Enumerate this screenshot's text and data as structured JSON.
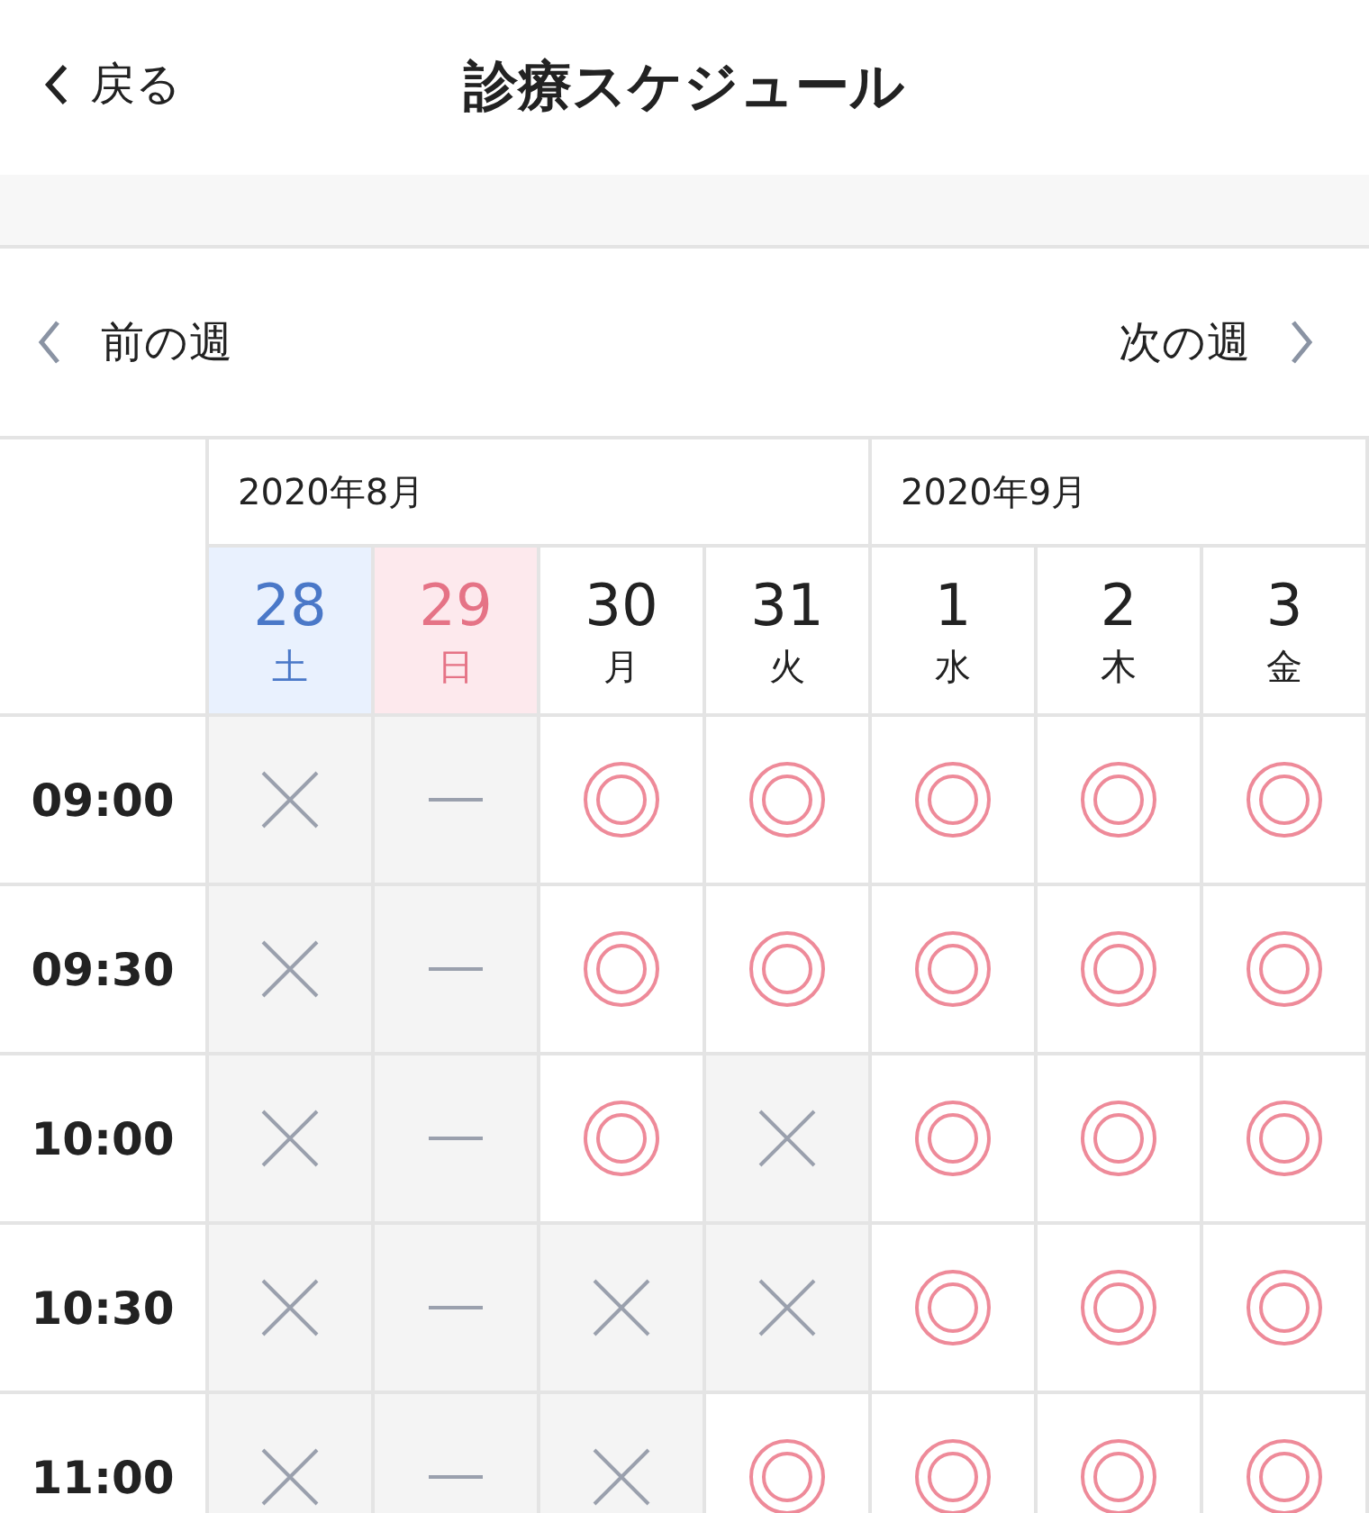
{
  "header": {
    "back": "戻る",
    "title": "診療スケジュール"
  },
  "week_nav": {
    "prev": "前の週",
    "next": "次の週"
  },
  "months": [
    {
      "label": "2020年8月",
      "days": [
        {
          "date": "28",
          "weekday": "土",
          "kind": "sat"
        },
        {
          "date": "29",
          "weekday": "日",
          "kind": "sun"
        },
        {
          "date": "30",
          "weekday": "月",
          "kind": "weekday"
        },
        {
          "date": "31",
          "weekday": "火",
          "kind": "weekday"
        }
      ]
    },
    {
      "label": "2020年9月",
      "days": [
        {
          "date": "1",
          "weekday": "水",
          "kind": "weekday"
        },
        {
          "date": "2",
          "weekday": "木",
          "kind": "weekday"
        },
        {
          "date": "3",
          "weekday": "金",
          "kind": "weekday"
        }
      ]
    }
  ],
  "slots": [
    {
      "time": "09:00",
      "cells": [
        {
          "kind": "full"
        },
        {
          "kind": "closed"
        },
        {
          "kind": "available"
        },
        {
          "kind": "available"
        },
        {
          "kind": "available"
        },
        {
          "kind": "available"
        },
        {
          "kind": "available"
        }
      ]
    },
    {
      "time": "09:30",
      "cells": [
        {
          "kind": "full"
        },
        {
          "kind": "closed"
        },
        {
          "kind": "available"
        },
        {
          "kind": "available"
        },
        {
          "kind": "available"
        },
        {
          "kind": "available"
        },
        {
          "kind": "available"
        }
      ]
    },
    {
      "time": "10:00",
      "cells": [
        {
          "kind": "full"
        },
        {
          "kind": "closed"
        },
        {
          "kind": "available"
        },
        {
          "kind": "full"
        },
        {
          "kind": "available"
        },
        {
          "kind": "available"
        },
        {
          "kind": "available"
        }
      ]
    },
    {
      "time": "10:30",
      "cells": [
        {
          "kind": "full"
        },
        {
          "kind": "closed"
        },
        {
          "kind": "full"
        },
        {
          "kind": "full"
        },
        {
          "kind": "available"
        },
        {
          "kind": "available"
        },
        {
          "kind": "available"
        }
      ]
    },
    {
      "time": "11:00",
      "cells": [
        {
          "kind": "full"
        },
        {
          "kind": "closed"
        },
        {
          "kind": "full"
        },
        {
          "kind": "available"
        },
        {
          "kind": "available"
        },
        {
          "kind": "available"
        },
        {
          "kind": "available"
        }
      ]
    }
  ]
}
